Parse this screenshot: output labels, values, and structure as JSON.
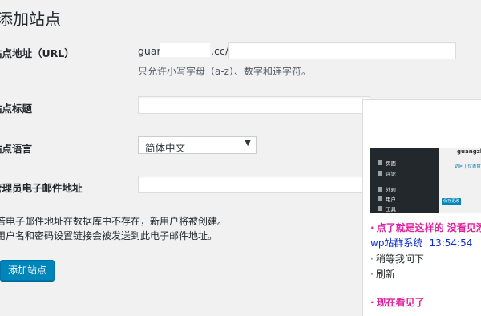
{
  "page": {
    "title": "添加站点"
  },
  "form": {
    "address_label": "站点地址（URL）",
    "address_prefix": "guan",
    "address_suffix": ".cc/",
    "address_hint": "只允许小写字母（a-z）、数字和连字符。",
    "title_label": "站点标题",
    "language_label": "站点语言",
    "language_value": "简体中文",
    "email_label": "管理员电子邮件地址",
    "note_line1": "若电子邮件地址在数据库中不存在，新用户将被创建。",
    "note_line2": "用户名和密码设置链接会被发送到此电子邮件地址。",
    "submit_label": "添加站点"
  },
  "chat": {
    "screenshot": {
      "site_title": "guangzh",
      "menu": [
        "页面",
        "评论",
        "外观",
        "用户",
        "工具"
      ],
      "link": "访问 | 仪表盘",
      "button": "保存更改"
    },
    "messages": [
      {
        "text": "点了就是这样的 没看见添加",
        "style": "red",
        "bullet": "·"
      },
      {
        "sender": "wp站群系统",
        "time": "13:54:54",
        "style": "blue"
      },
      {
        "text": "稍等我问下",
        "style": "plain",
        "bullet": "·"
      },
      {
        "text": "刷新",
        "style": "plain",
        "bullet": "·"
      },
      {
        "text": "现在看见了",
        "style": "red",
        "bullet": "·"
      }
    ]
  }
}
